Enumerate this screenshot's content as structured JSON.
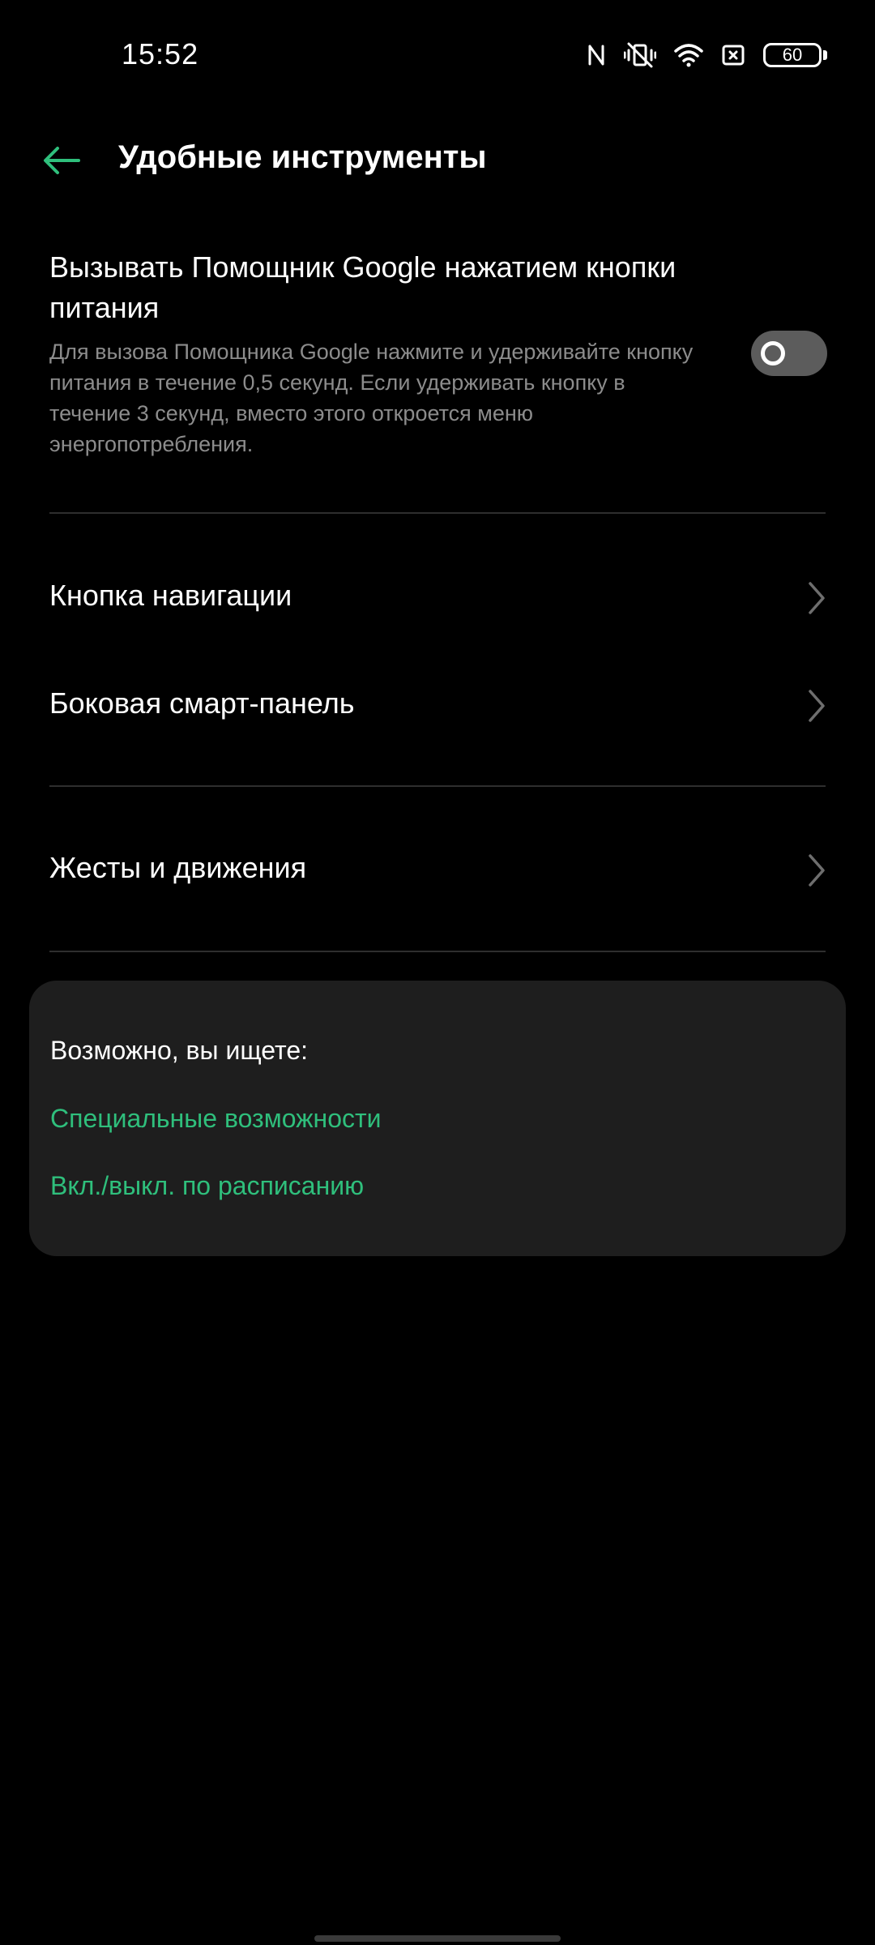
{
  "status_bar": {
    "time": "15:52",
    "battery_level": "60",
    "icons": [
      "nfc-icon",
      "vibrate-off-icon",
      "wifi-icon",
      "sim-icon",
      "battery-icon"
    ]
  },
  "header": {
    "back_icon": "arrow-left-icon",
    "title": "Удобные инструменты"
  },
  "assistant_setting": {
    "title": "Вызывать Помощник Google нажатием кнопки питания",
    "description": "Для вызова Помощника Google нажмите и удерживайте кнопку питания в течение 0,5 секунд. Если удерживать кнопку в течение 3 секунд, вместо этого откроется меню энергопотребления.",
    "enabled": false
  },
  "menu": {
    "items": [
      {
        "label": "Кнопка навигации",
        "icon": "chevron-right-icon"
      },
      {
        "label": "Боковая смарт-панель",
        "icon": "chevron-right-icon"
      },
      {
        "label": "Жесты и движения",
        "icon": "chevron-right-icon"
      }
    ]
  },
  "suggestions": {
    "heading": "Возможно, вы ищете:",
    "links": [
      "Специальные возможности",
      "Вкл./выкл. по расписанию"
    ]
  },
  "colors": {
    "accent": "#2fbf7c",
    "background": "#000000",
    "card": "#1e1e1e",
    "secondary_text": "#8c8c8c",
    "divider": "#2e2e2e"
  }
}
